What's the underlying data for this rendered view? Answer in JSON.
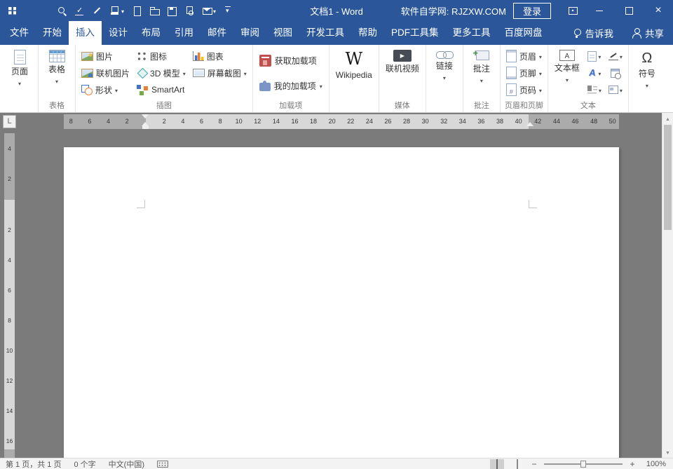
{
  "colors": {
    "titlebar": "#2B579A",
    "accent": "#2B579A",
    "canvas_bg": "#7B7B7B",
    "page_bg": "#FFFFFF"
  },
  "titlebar": {
    "qat_icons": [
      "view-grid",
      "search",
      "spellcheck",
      "edit",
      "ink-color",
      "new-document",
      "open-folder",
      "save",
      "print-preview",
      "email",
      "customize-qat"
    ],
    "document_title": "文档1 - Word",
    "promo_text": "软件自学网: RJZXW.COM",
    "login_label": "登录",
    "window_controls": [
      "ribbon-display-options",
      "minimize",
      "maximize",
      "close"
    ]
  },
  "ribbon": {
    "tabs": [
      {
        "label": "文件"
      },
      {
        "label": "开始"
      },
      {
        "label": "插入",
        "active": true
      },
      {
        "label": "设计"
      },
      {
        "label": "布局"
      },
      {
        "label": "引用"
      },
      {
        "label": "邮件"
      },
      {
        "label": "审阅"
      },
      {
        "label": "视图"
      },
      {
        "label": "开发工具"
      },
      {
        "label": "帮助"
      },
      {
        "label": "PDF工具集"
      },
      {
        "label": "更多工具"
      },
      {
        "label": "百度网盘"
      }
    ],
    "tell_me": "告诉我",
    "share": "共享",
    "groups": {
      "pages": {
        "button": "页面"
      },
      "tables": {
        "button": "表格",
        "label": "表格"
      },
      "illustrations": {
        "label": "插图",
        "items": [
          "图片",
          "联机图片",
          "形状",
          "图标",
          "3D 模型",
          "SmartArt",
          "图表",
          "屏幕截图"
        ]
      },
      "addins": {
        "label": "加载项",
        "items": [
          "获取加载项",
          "我的加载项"
        ]
      },
      "wikipedia": {
        "button": "Wikipedia"
      },
      "media": {
        "label": "媒体",
        "button": "联机视频"
      },
      "links": {
        "button": "链接"
      },
      "comments": {
        "label": "批注",
        "button": "批注"
      },
      "header_footer": {
        "label": "页眉和页脚",
        "items": [
          "页眉",
          "页脚",
          "页码"
        ]
      },
      "text": {
        "label": "文本",
        "button": "文本框",
        "icon_buttons": [
          "quick-parts",
          "wordart",
          "drop-cap",
          "signature-line",
          "date-and-time",
          "object"
        ]
      },
      "symbols": {
        "button": "符号"
      }
    }
  },
  "ruler": {
    "h_left": [
      "8",
      "6",
      "4",
      "2"
    ],
    "h_center": [
      "2",
      "4",
      "6",
      "8",
      "10",
      "12",
      "14",
      "16",
      "18",
      "20",
      "22",
      "24",
      "26",
      "28",
      "30",
      "32",
      "34",
      "36",
      "38",
      "40"
    ],
    "h_right": [
      "42",
      "44",
      "46",
      "48",
      "50"
    ],
    "v_top": [
      "4",
      "2"
    ],
    "v_main": [
      "2",
      "4",
      "6",
      "8",
      "10",
      "12",
      "14",
      "16"
    ]
  },
  "statusbar": {
    "page_info": "第 1 页，共 1 页",
    "word_count": "0 个字",
    "language": "中文(中国)",
    "view_icons": [
      "read-mode",
      "print-layout",
      "web-layout"
    ],
    "zoom_out": "−",
    "zoom_in": "+",
    "zoom_level": "100%"
  }
}
